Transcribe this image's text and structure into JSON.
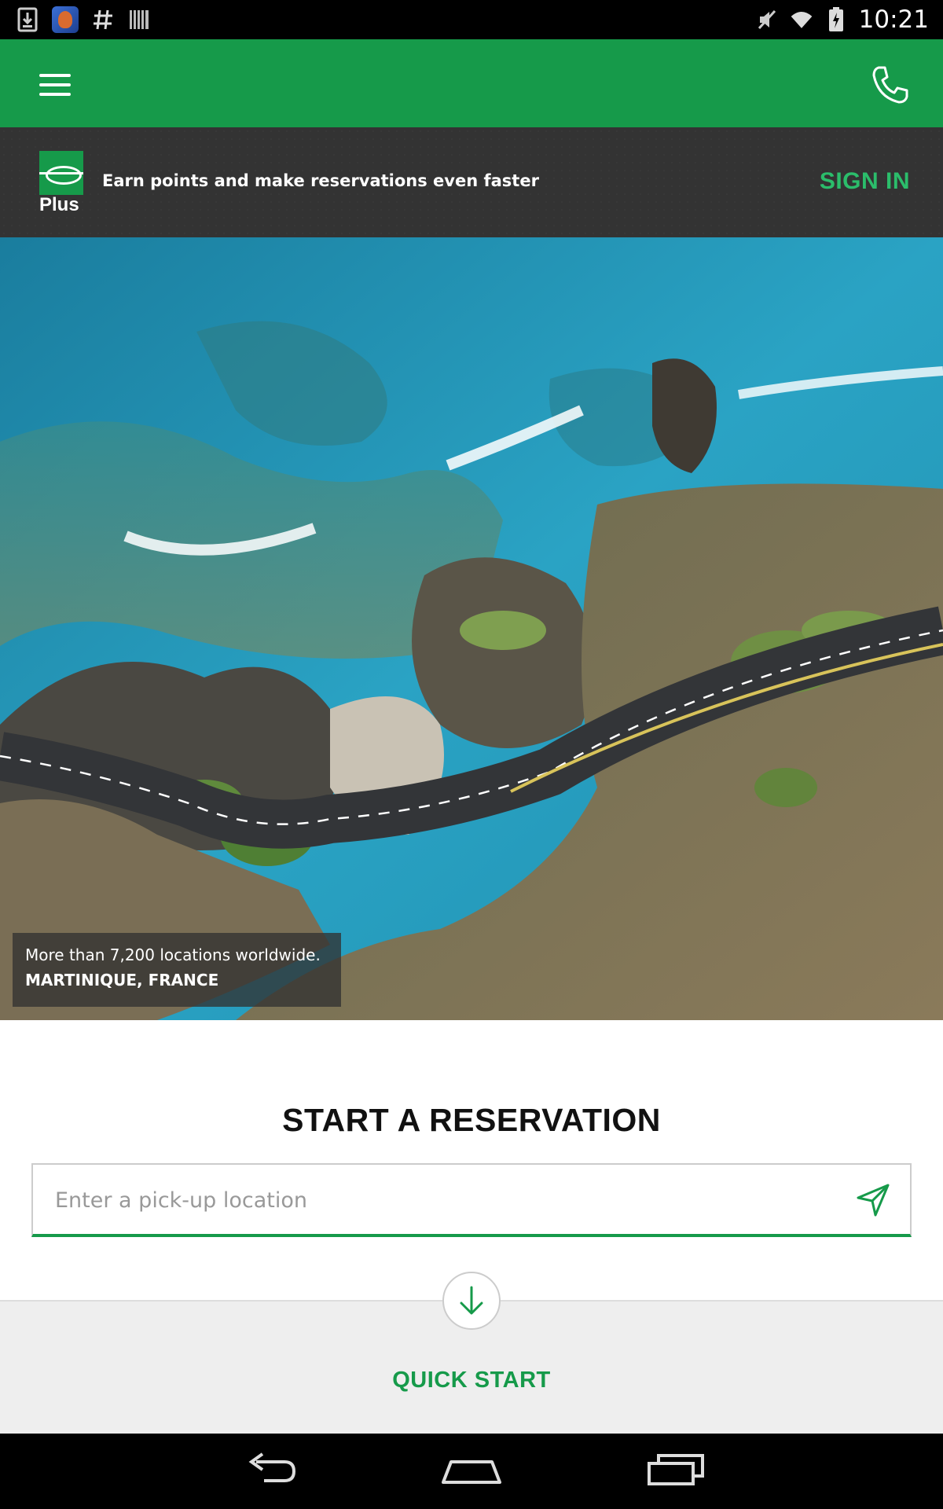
{
  "status_bar": {
    "time": "10:21",
    "left_icons": [
      "download-icon",
      "app-icon",
      "hash-icon",
      "barcode-icon"
    ],
    "right_icons": [
      "mute-icon",
      "wifi-icon",
      "battery-icon"
    ]
  },
  "app_bar": {
    "color": "#169a4a",
    "menu_icon": "menu-icon",
    "phone_icon": "phone-icon"
  },
  "plus_banner": {
    "logo_text": "Plus",
    "message": "Earn points and make reservations even faster",
    "sign_in_label": "SIGN IN"
  },
  "hero": {
    "caption_line1": "More than 7,200 locations worldwide.",
    "caption_line2": "MARTINIQUE, FRANCE"
  },
  "reservation": {
    "title": "START A RESERVATION",
    "location_placeholder": "Enter a pick-up location",
    "location_value": "",
    "gps_icon": "navigation-arrow-icon"
  },
  "quick_start": {
    "label": "QUICK START",
    "icon": "arrow-down-icon"
  },
  "nav_bar": {
    "buttons": [
      "back-icon",
      "home-icon",
      "recents-icon"
    ]
  },
  "colors": {
    "brand_green": "#169a4a",
    "sign_in_green": "#2bbd6b",
    "banner_dark": "#333333"
  }
}
